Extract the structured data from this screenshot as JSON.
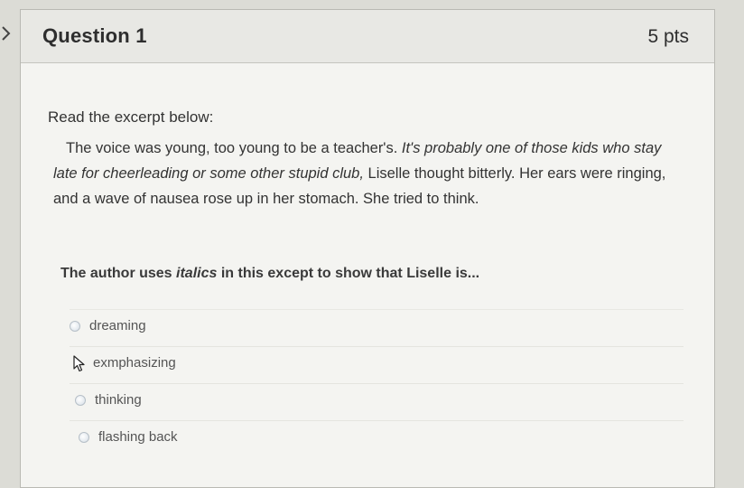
{
  "question": {
    "title": "Question 1",
    "points": "5 pts"
  },
  "body": {
    "intro": "Read the excerpt below:",
    "excerpt": {
      "part1": "The voice was young, too young to be a teacher's. ",
      "italic": "It's probably one of those kids who stay late for cheerleading or some other stupid club,",
      "part2": " Liselle thought bitterly. Her ears were ringing, and a wave of nausea rose up in her stomach. She tried to think."
    },
    "prompt": {
      "before": "The author uses ",
      "italic_word": "italics",
      "after": " in this except to show that Liselle is..."
    }
  },
  "answers": [
    {
      "label": "dreaming"
    },
    {
      "label": "exmphasizing"
    },
    {
      "label": "thinking"
    },
    {
      "label": "flashing back"
    }
  ],
  "icons": {
    "toggle": "chevron-right-icon",
    "radio": "radio-button-icon",
    "cursor": "mouse-pointer-icon"
  },
  "colors": {
    "background": "#dcdcd6",
    "card": "#f4f4f1",
    "header": "#e8e8e4",
    "text": "#333333"
  }
}
